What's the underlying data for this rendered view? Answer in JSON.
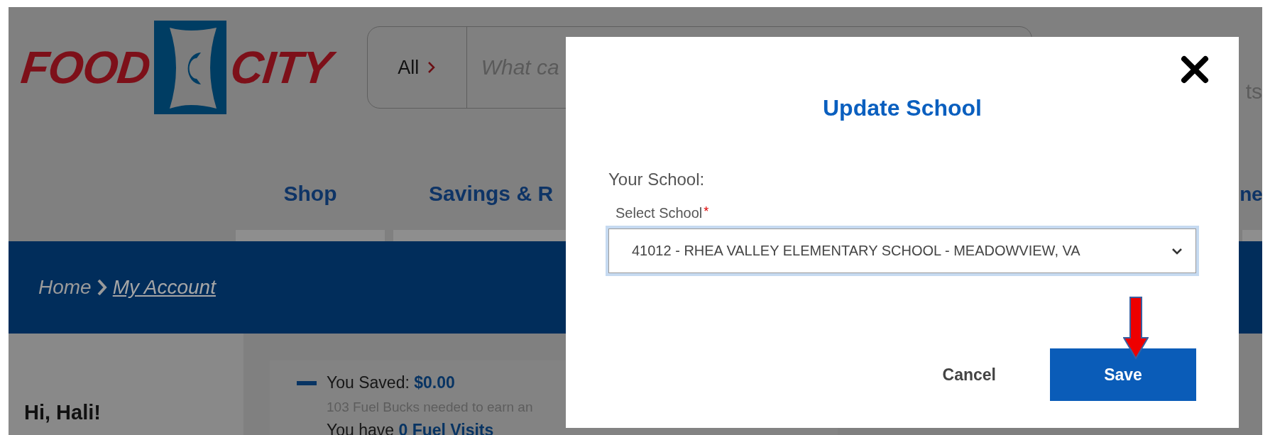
{
  "logo": {
    "left": "FOOD",
    "right": "CITY"
  },
  "search": {
    "scope": "All",
    "placeholder": "What ca"
  },
  "header_right": "ts",
  "nav": [
    {
      "label": "Shop"
    },
    {
      "label": "Savings & R"
    },
    {
      "label": "ne"
    }
  ],
  "breadcrumb": [
    {
      "label": "Home",
      "current": false
    },
    {
      "label": "My Account",
      "current": true
    }
  ],
  "greeting": "Hi, Hali!",
  "savings": {
    "label": "You Saved: **$0.00**",
    "note": "103 Fuel Bucks needed to earn an",
    "visits": "You have **0 Fuel Visits**"
  },
  "modal": {
    "title": "Update School",
    "field_label": "Your School:",
    "select_label": "Select School",
    "required_mark": "*",
    "value": "41012 - RHEA VALLEY ELEMENTARY SCHOOL - MEADOWVIEW, VA",
    "buttons": [
      {
        "label": "Cancel",
        "kind": "text"
      },
      {
        "label": "Save",
        "kind": "primary"
      }
    ]
  }
}
